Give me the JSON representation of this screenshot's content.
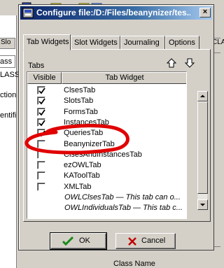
{
  "background": {
    "left_labels": [
      "Slo",
      "ass",
      "LASS",
      "ction",
      "entifi"
    ],
    "right_label": "CLA",
    "bottom_label": "Class Name",
    "toolbar_glyphs": [
      "A",
      "R"
    ]
  },
  "dialog": {
    "title": "Configure file:/D:/Files/beanynizer/tes...",
    "close_glyph": "×",
    "tabs": [
      {
        "label": "Tab Widgets",
        "active": true
      },
      {
        "label": "Slot Widgets",
        "active": false
      },
      {
        "label": "Journaling",
        "active": false
      },
      {
        "label": "Options",
        "active": false
      }
    ],
    "section_label": "Tabs",
    "icons": {
      "move_up": "move-up-icon",
      "move_down": "move-down-icon"
    },
    "table": {
      "headers": {
        "visible": "Visible",
        "widget": "Tab Widget"
      },
      "rows": [
        {
          "label": "ClsesTab",
          "checked": true
        },
        {
          "label": "SlotsTab",
          "checked": true
        },
        {
          "label": "FormsTab",
          "checked": true
        },
        {
          "label": "InstancesTab",
          "checked": true
        },
        {
          "label": "QueriesTab",
          "checked": true
        },
        {
          "label": "BeanynizerTab",
          "checked": false
        },
        {
          "label": "ClsesAndInstancesTab",
          "checked": false
        },
        {
          "label": "ezOWLTab",
          "checked": false
        },
        {
          "label": "KAToolTab",
          "checked": false
        },
        {
          "label": "XMLTab",
          "checked": false
        },
        {
          "label": "OWLClsesTab — This tab can o...",
          "checked": null
        },
        {
          "label": "OWLIndividualsTab — This tab c...",
          "checked": null
        }
      ]
    },
    "buttons": {
      "ok": "OK",
      "cancel": "Cancel"
    },
    "colors": {
      "title_gradient_start": "#0a246a",
      "title_gradient_end": "#a6caf0",
      "annotation_red": "#e00000",
      "ok_check": "#1a8a1a",
      "cancel_x": "#c00000"
    }
  }
}
